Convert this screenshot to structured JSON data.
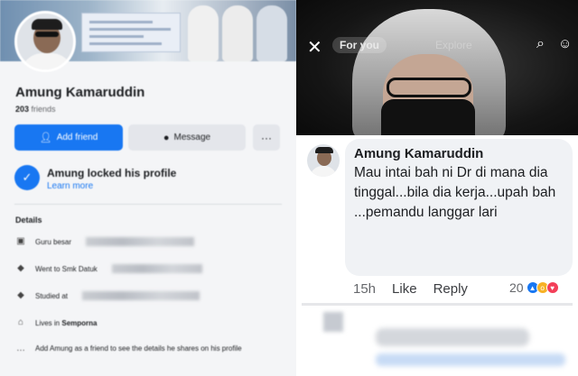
{
  "profile": {
    "name": "Amung Kamaruddin",
    "friends_count": "203",
    "friends_label": "friends",
    "add_friend_label": "Add friend",
    "message_label": "Message",
    "more_label": "···",
    "locked_title": "Amung locked his profile",
    "learn_more": "Learn more",
    "details_heading": "Details",
    "details": {
      "work": "Guru besar",
      "went_to": "Went to Smk Datuk",
      "studied_at": "Studied at",
      "lives_in_prefix": "Lives in",
      "lives_in_place": "Semporna",
      "add_friend_note": "Add Amung as a friend to see the details he shares on his profile"
    }
  },
  "video": {
    "tab_for_you": "For you",
    "tab_explore": "Explore",
    "close_icon": "close-icon",
    "search_icon": "search-icon",
    "profile_icon": "profile-icon"
  },
  "comment": {
    "author": "Amung Kamaruddin",
    "text": "Mau intai bah ni Dr di mana dia tinggal...bila dia kerja...upah bah ...pemandu langgar lari",
    "time": "15h",
    "like_label": "Like",
    "reply_label": "Reply",
    "reaction_count": "20"
  },
  "colors": {
    "facebook_blue": "#1877f2",
    "bubble_gray": "#f0f2f5"
  }
}
